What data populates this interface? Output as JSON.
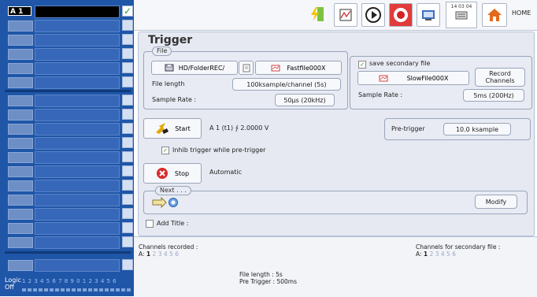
{
  "sidebar": {
    "active_channel": "A 1",
    "logic_title": "Logic Off",
    "logic_numbers": "1 2 3 4 5 6 7 8 9 0 1 2 3 4 5 6"
  },
  "toolbar": {
    "time": "14 03 04",
    "home_label": "HOME"
  },
  "trigger": {
    "title": "Trigger",
    "file_legend": "File",
    "folder": "HD/FolderREC/",
    "file_name": "Fastfile000X",
    "file_length_label": "File length",
    "file_length_value": "100ksample/channel (5s)",
    "sample_rate_label": "Sample Rate :",
    "sample_rate_value": "50µs (20kHz)",
    "secondary_label": "save secondary file",
    "secondary_file": "SlowFile000X",
    "record_channels_label": "Record Channels",
    "secondary_rate_label": "Sample Rate :",
    "secondary_rate_value": "5ms (200Hz)",
    "start_label": "Start",
    "start_condition": "A 1 (t1) ∱ 2.0000 V",
    "pretrigger_label": "Pre-trigger",
    "pretrigger_value": "10.0 ksample",
    "inhib_label": "Inhib  trigger while pre-trigger",
    "stop_label": "Stop",
    "stop_mode": "Automatic",
    "next_legend": "Next . . .",
    "modify_label": "Modify",
    "add_title_label": "Add Title :"
  },
  "summary": {
    "channels_recorded_label": "Channels recorded :",
    "channels_secondary_label": "Channels for secondary file :",
    "channel_prefix": "A:",
    "channels": [
      "1",
      "2",
      "3",
      "4",
      "5",
      "6"
    ],
    "file_length_line": "File length    : 5s",
    "pretrigger_line": "Pre Trigger  : 500ms"
  }
}
